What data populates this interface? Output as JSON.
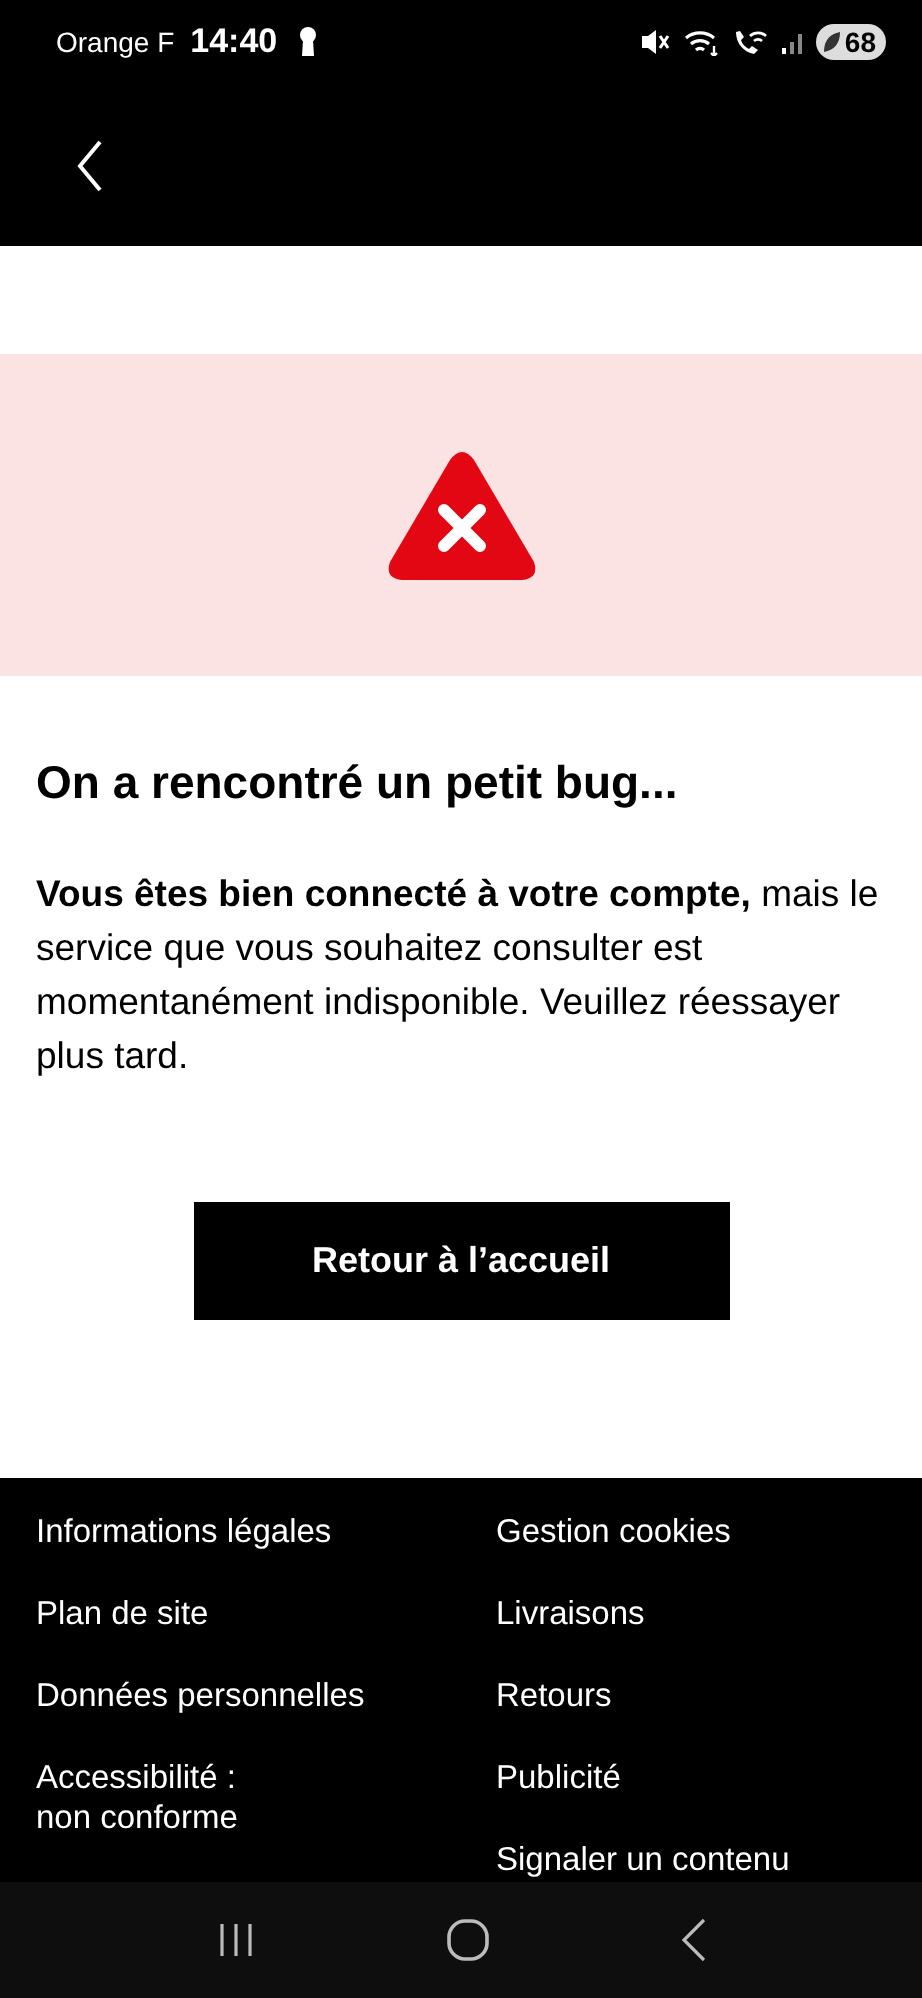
{
  "status_bar": {
    "carrier": "Orange F",
    "time": "14:40",
    "battery": "68"
  },
  "error": {
    "title": "On a rencontré un petit bug...",
    "message": "**Vous êtes bien connecté à votre compte,** mais le service que vous souhaitez consulter est momentanément indisponible. Veuillez réessayer plus tard.",
    "button": "Retour à l’accueil"
  },
  "footer": {
    "left": [
      "Informations légales",
      "Plan de site",
      "Données personnelles",
      "Accessibilité :\nnon conforme"
    ],
    "right": [
      "Gestion cookies",
      "Livraisons",
      "Retours",
      "Publicité",
      "Signaler un contenu"
    ]
  }
}
